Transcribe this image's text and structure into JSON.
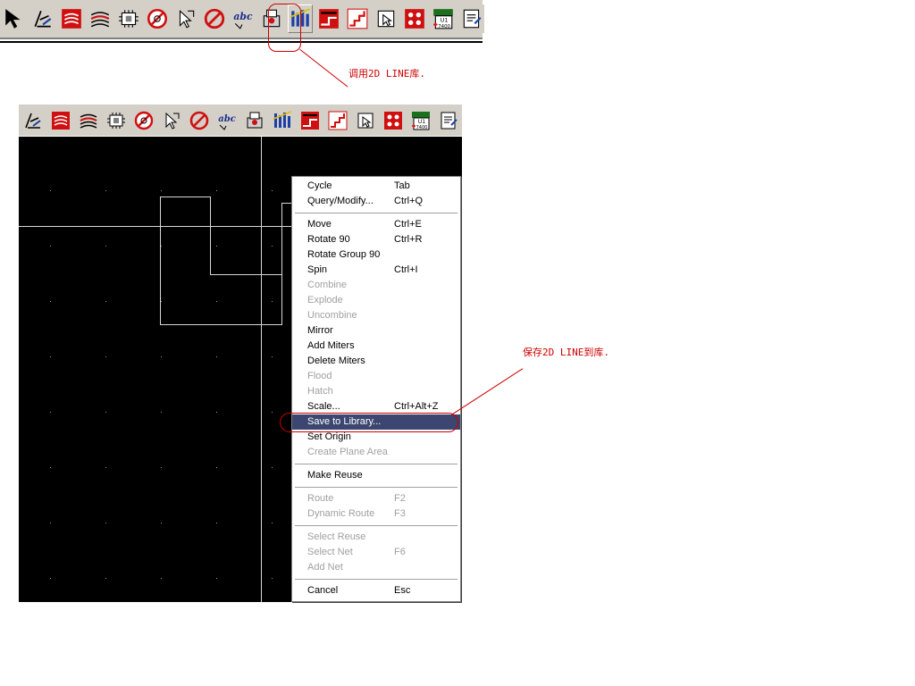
{
  "annotations": {
    "top": "调用2D LINE库.",
    "menu": "保存2D LINE到库."
  },
  "toolbar_top": {
    "icons": [
      "pointer-icon",
      "sketch-line-icon",
      "layer-red-icon",
      "layer-stack-icon",
      "component-icon",
      "no-pin-icon",
      "select-cursor-icon",
      "prohibit-icon",
      "text-abc-icon",
      "print-part-icon",
      "library-2d-line-icon",
      "mirror-red-icon",
      "staircase-icon",
      "move-part-icon",
      "via-grid-icon",
      "u1-7400-icon",
      "properties-icon"
    ],
    "highlighted": "library-2d-line-icon"
  },
  "toolbar_bottom": {
    "icons": [
      "sketch-line-icon",
      "layer-red-icon",
      "layer-stack-icon",
      "component-icon",
      "no-pin-icon",
      "select-cursor-icon",
      "prohibit-icon",
      "text-abc-icon",
      "print-part-icon",
      "library-2d-line-icon",
      "mirror-red-icon",
      "staircase-icon",
      "move-part-icon",
      "via-grid-icon",
      "u1-7400-icon",
      "properties-icon"
    ]
  },
  "context_menu": {
    "items": [
      {
        "label": "Cycle",
        "shortcut": "Tab",
        "state": "enabled"
      },
      {
        "label": "Query/Modify...",
        "shortcut": "Ctrl+Q",
        "state": "enabled"
      },
      {
        "separator": true
      },
      {
        "label": "Move",
        "shortcut": "Ctrl+E",
        "state": "enabled"
      },
      {
        "label": "Rotate 90",
        "shortcut": "Ctrl+R",
        "state": "enabled"
      },
      {
        "label": "Rotate Group 90",
        "shortcut": "",
        "state": "enabled"
      },
      {
        "label": "Spin",
        "shortcut": "Ctrl+I",
        "state": "enabled"
      },
      {
        "label": "Combine",
        "shortcut": "",
        "state": "disabled"
      },
      {
        "label": "Explode",
        "shortcut": "",
        "state": "disabled"
      },
      {
        "label": "Uncombine",
        "shortcut": "",
        "state": "disabled"
      },
      {
        "label": "Mirror",
        "shortcut": "",
        "state": "enabled"
      },
      {
        "label": "Add Miters",
        "shortcut": "",
        "state": "enabled"
      },
      {
        "label": "Delete Miters",
        "shortcut": "",
        "state": "enabled"
      },
      {
        "label": "Flood",
        "shortcut": "",
        "state": "disabled"
      },
      {
        "label": "Hatch",
        "shortcut": "",
        "state": "disabled"
      },
      {
        "label": "Scale...",
        "shortcut": "Ctrl+Alt+Z",
        "state": "enabled"
      },
      {
        "label": "Save to Library...",
        "shortcut": "",
        "state": "selected"
      },
      {
        "label": "Set Origin",
        "shortcut": "",
        "state": "enabled"
      },
      {
        "label": "Create Plane Area",
        "shortcut": "",
        "state": "disabled"
      },
      {
        "separator": true
      },
      {
        "label": "Make Reuse",
        "shortcut": "",
        "state": "enabled"
      },
      {
        "separator": true
      },
      {
        "label": "Route",
        "shortcut": "F2",
        "state": "disabled"
      },
      {
        "label": "Dynamic Route",
        "shortcut": "F3",
        "state": "disabled"
      },
      {
        "separator": true
      },
      {
        "label": "Select Reuse",
        "shortcut": "",
        "state": "disabled"
      },
      {
        "label": "Select Net",
        "shortcut": "F6",
        "state": "disabled"
      },
      {
        "label": "Add Net",
        "shortcut": "",
        "state": "disabled"
      },
      {
        "separator": true
      },
      {
        "label": "Cancel",
        "shortcut": "Esc",
        "state": "enabled"
      }
    ]
  },
  "icon_glyphs": {
    "u1_label": "U1",
    "u1_sub": "7400",
    "abc": "abc"
  }
}
